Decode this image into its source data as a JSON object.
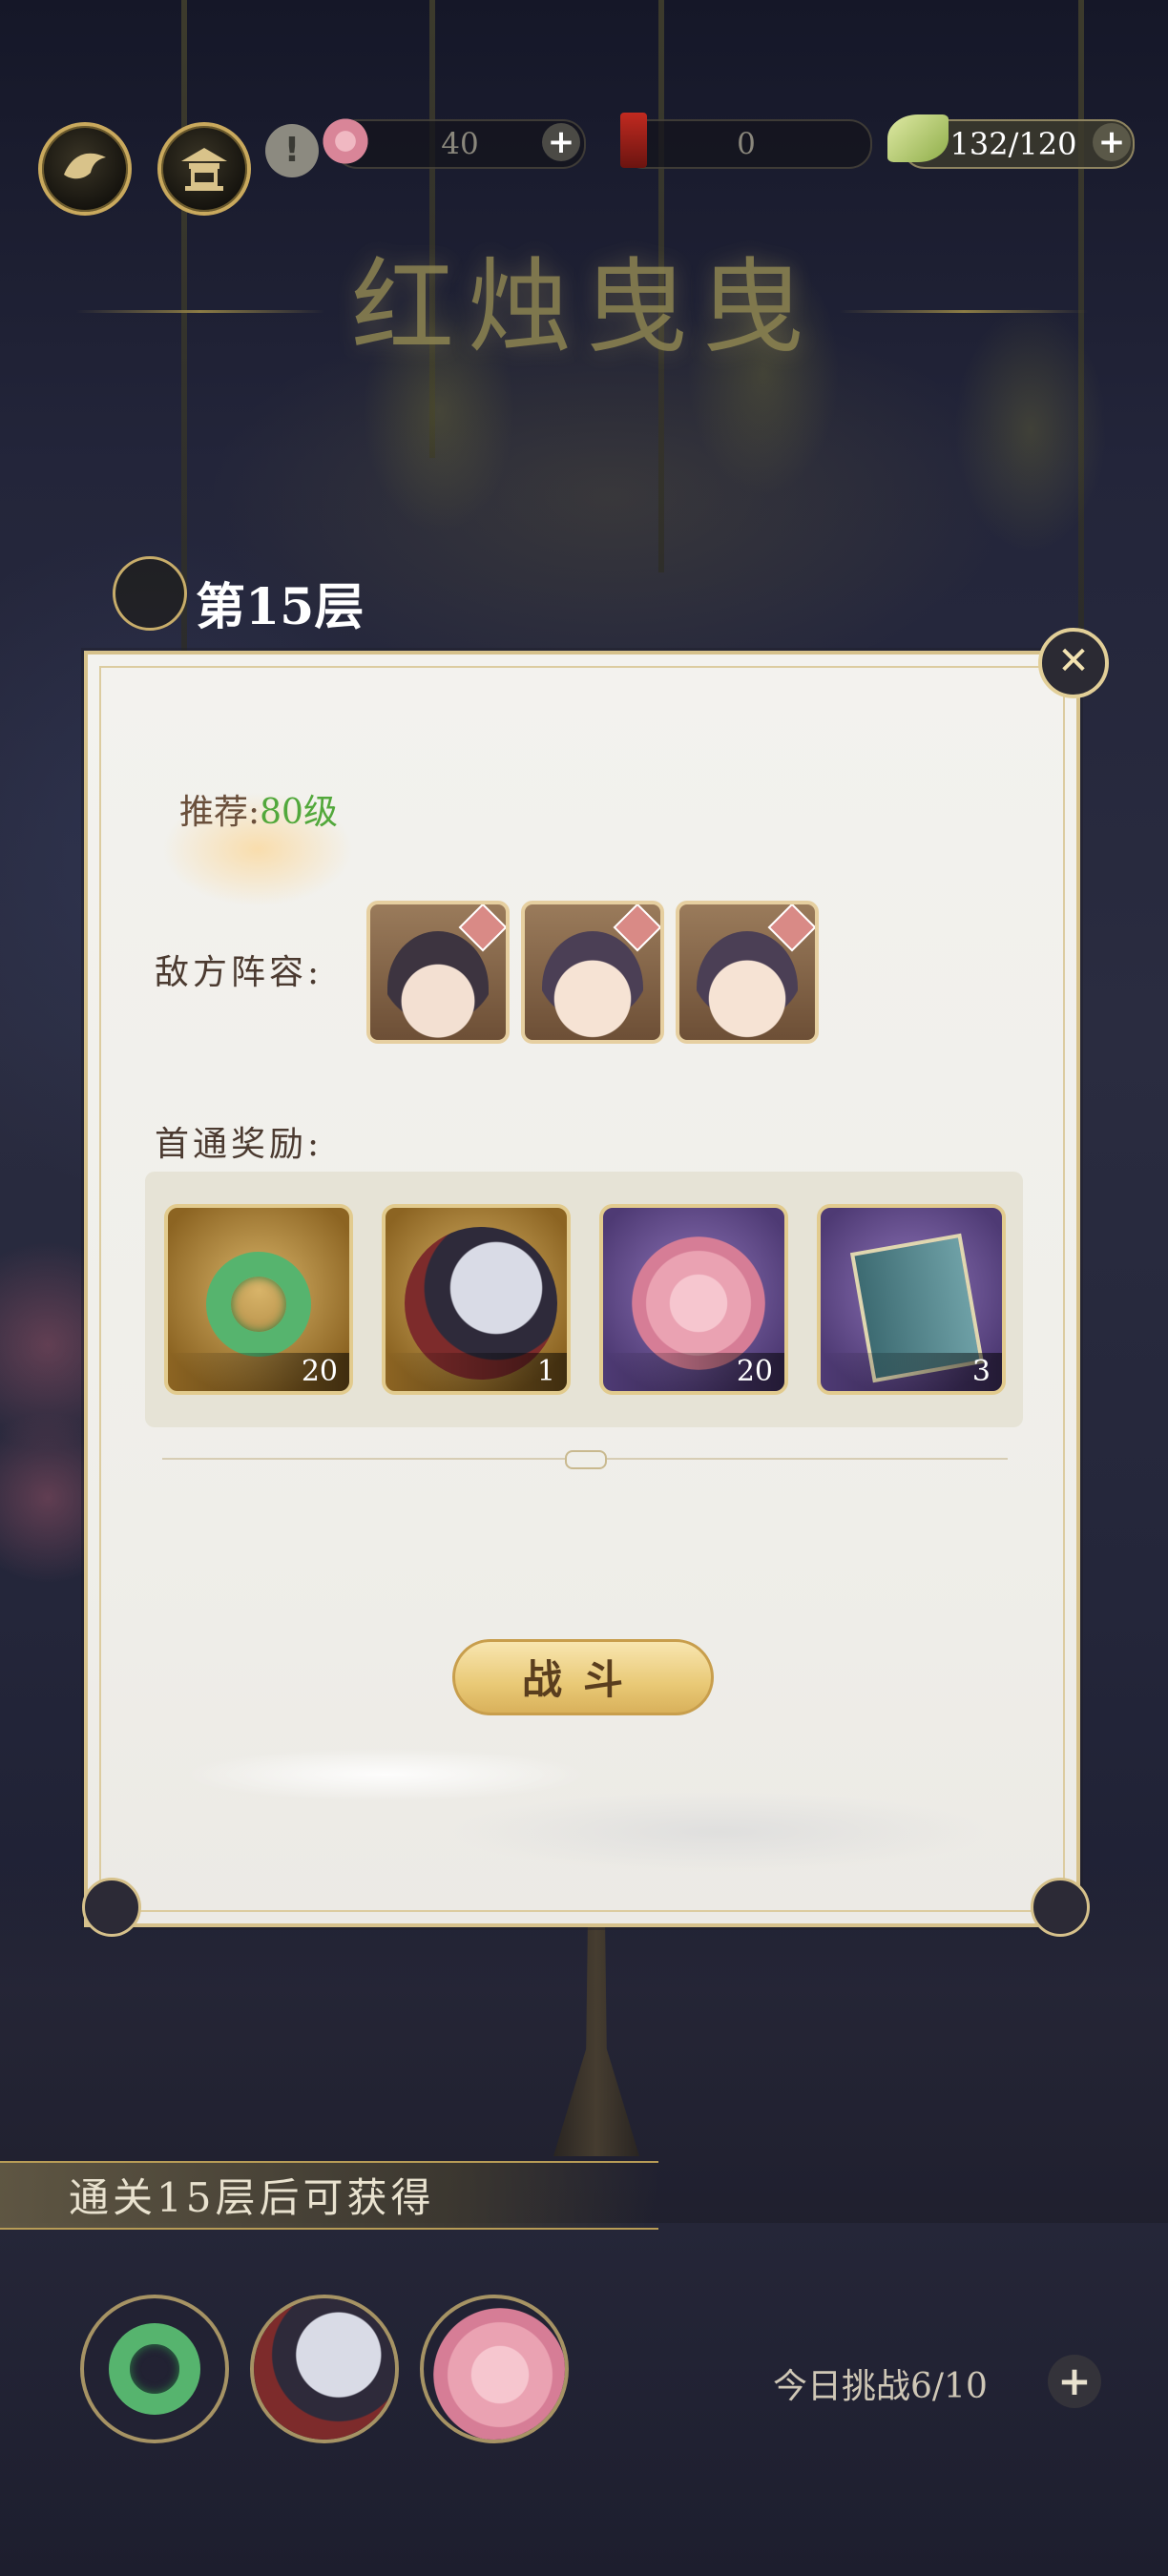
{
  "top_bar": {
    "resource_1": {
      "value": "40",
      "icon": "flower-icon"
    },
    "resource_2": {
      "value": "0",
      "icon": "candle-icon"
    },
    "stamina": {
      "value": "132/120",
      "icon": "leaf-icon"
    },
    "plus_symbol": "+",
    "warning_symbol": "!"
  },
  "banner": {
    "title": "红烛曳曳"
  },
  "floor": {
    "label": "第15层"
  },
  "panel": {
    "recommend_prefix": "推荐:",
    "recommend_level": "80级",
    "enemy_label": "敌方阵容:",
    "enemies": [
      "enemy-girl-white-flower",
      "enemy-girl-purple-hair",
      "enemy-girl-purple-hair"
    ],
    "reward_label": "首通奖励:",
    "rewards": [
      {
        "name": "jade-pendant",
        "count": "20"
      },
      {
        "name": "hero-portrait",
        "count": "1"
      },
      {
        "name": "pink-peony",
        "count": "20"
      },
      {
        "name": "book",
        "count": "3"
      }
    ],
    "fight_button": "战斗",
    "close_symbol": "✕"
  },
  "bottom": {
    "unlock_text": "通关15层后可获得",
    "challenge_text": "今日挑战6/10"
  },
  "colors": {
    "gold": "#d6c18b",
    "green_level": "#52a83b"
  }
}
